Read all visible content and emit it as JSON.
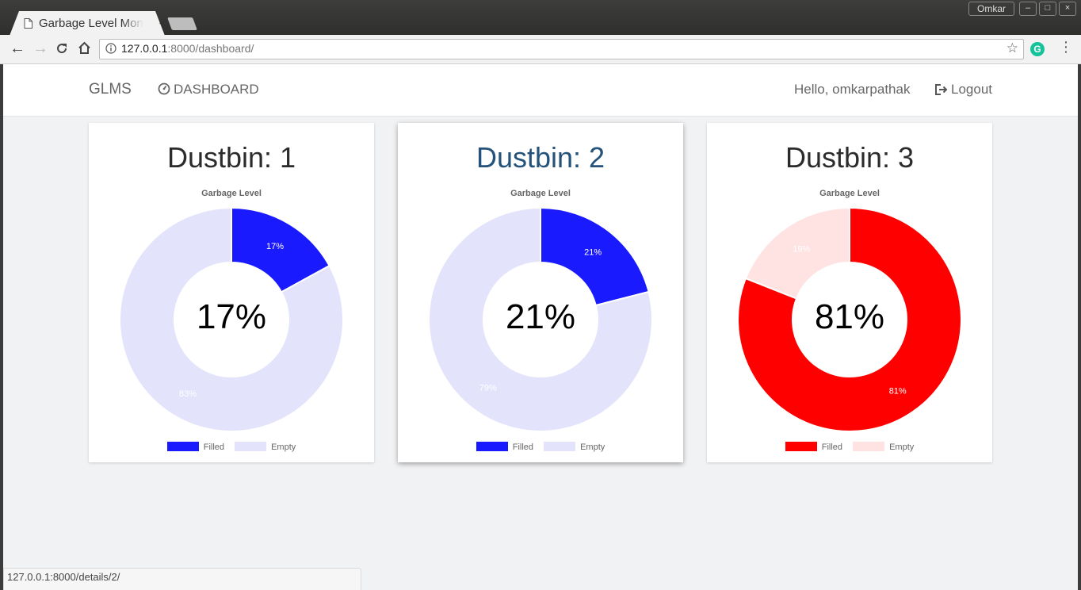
{
  "browser": {
    "tab_title": "Garbage Level Monitoring System",
    "tab_close": "×",
    "profile_name": "Omkar",
    "window_buttons": [
      "–",
      "□",
      "×"
    ],
    "url_host": "127.0.0.1",
    "url_rest": ":8000/dashboard/",
    "status_url": "127.0.0.1:8000/details/2/",
    "icons": [
      "back-arrow-icon",
      "forward-arrow-icon",
      "reload-icon",
      "home-icon",
      "info-icon",
      "bookmark-star-icon",
      "grammarly-extension-icon",
      "menu-icon"
    ]
  },
  "navbar": {
    "brand": "GLMS",
    "dashboard": "DASHBOARD",
    "greeting": "Hello, omkarpathak",
    "logout": "Logout"
  },
  "colors": {
    "blue_filled": "#1a1aff",
    "blue_empty": "#e3e3fb",
    "red_filled": "#ff0000",
    "red_empty": "#ffe2e2"
  },
  "cards": [
    {
      "title": "Dustbin: 1",
      "chart_title": "Garbage Level",
      "center": "17%",
      "legend_filled": "Filled",
      "legend_empty": "Empty"
    },
    {
      "title": "Dustbin: 2",
      "chart_title": "Garbage Level",
      "center": "21%",
      "legend_filled": "Filled",
      "legend_empty": "Empty"
    },
    {
      "title": "Dustbin: 3",
      "chart_title": "Garbage Level",
      "center": "81%",
      "legend_filled": "Filled",
      "legend_empty": "Empty"
    }
  ],
  "chart_data": [
    {
      "type": "pie",
      "variant": "doughnut",
      "title": "Garbage Level",
      "categories": [
        "Filled",
        "Empty"
      ],
      "values": [
        17,
        83
      ],
      "labels": [
        "17%",
        "83%"
      ],
      "colors": [
        "#1a1aff",
        "#e3e3fb"
      ],
      "legend": "bottom"
    },
    {
      "type": "pie",
      "variant": "doughnut",
      "title": "Garbage Level",
      "categories": [
        "Filled",
        "Empty"
      ],
      "values": [
        21,
        79
      ],
      "labels": [
        "21%",
        "79%"
      ],
      "colors": [
        "#1a1aff",
        "#e3e3fb"
      ],
      "legend": "bottom"
    },
    {
      "type": "pie",
      "variant": "doughnut",
      "title": "Garbage Level",
      "categories": [
        "Filled",
        "Empty"
      ],
      "values": [
        81,
        19
      ],
      "labels": [
        "81%",
        "19%"
      ],
      "colors": [
        "#ff0000",
        "#ffe2e2"
      ],
      "legend": "bottom"
    }
  ]
}
